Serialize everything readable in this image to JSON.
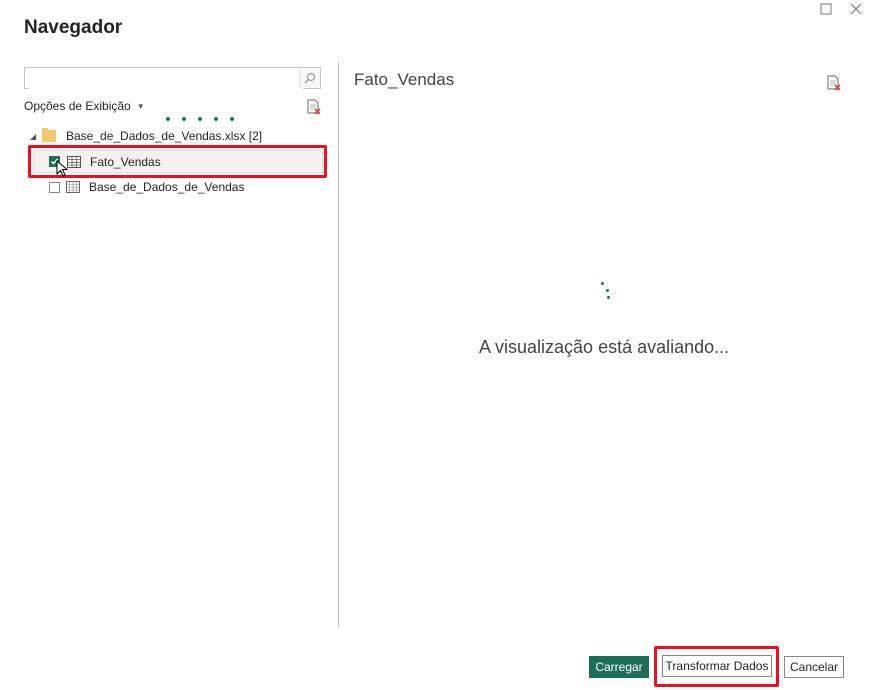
{
  "window": {
    "title": "Navegador",
    "controls": [
      "maximize",
      "close"
    ]
  },
  "left_panel": {
    "search": {
      "value": "",
      "placeholder": ""
    },
    "display_options": {
      "label": "Opções de Exibição"
    },
    "tree": {
      "folder": {
        "label": "Base_de_Dados_de_Vendas.xlsx [2]"
      },
      "items": [
        {
          "label": "Fato_Vendas",
          "checked": true,
          "selected": true,
          "icon": "table-icon"
        },
        {
          "label": "Base_de_Dados_de_Vendas",
          "checked": false,
          "selected": false,
          "icon": "sheet-icon"
        }
      ]
    }
  },
  "preview": {
    "title": "Fato_Vendas",
    "status": "A visualização está avaliando..."
  },
  "footer": {
    "load_label": "Carregar",
    "transform_label": "Transformar Dados",
    "cancel_label": "Cancelar"
  },
  "colors": {
    "accent": "#1b6f56",
    "highlight": "#e81123",
    "loading_dots": "#217346"
  }
}
